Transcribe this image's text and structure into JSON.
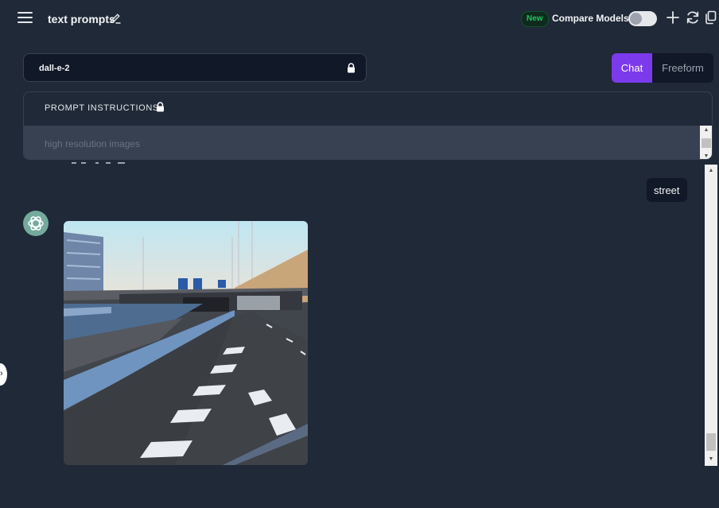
{
  "header": {
    "title": "text prompts",
    "badge_new": "New",
    "compare_models_label": "Compare Models",
    "compare_models_enabled": false,
    "icons": [
      "menu-icon",
      "edit-icon",
      "plus-icon",
      "refresh-icon",
      "copy-icon"
    ]
  },
  "model_select": {
    "value": "dall-e-2",
    "locked": true
  },
  "mode_tabs": [
    {
      "label": "Chat",
      "active": true
    },
    {
      "label": "Freeform",
      "active": false
    }
  ],
  "prompt_instructions": {
    "label": "PROMPT INSTRUCTIONS",
    "locked": true,
    "placeholder": "high resolution images"
  },
  "conversation": [
    {
      "role": "user",
      "text": "street"
    },
    {
      "role": "assistant",
      "content": "generated-image",
      "image_subject": "street-underpass-image"
    }
  ],
  "colors": {
    "background": "#1f2937",
    "accent": "#7c3aed",
    "badge_green": "#22c55e",
    "assistant_avatar": "#74aa9c"
  }
}
